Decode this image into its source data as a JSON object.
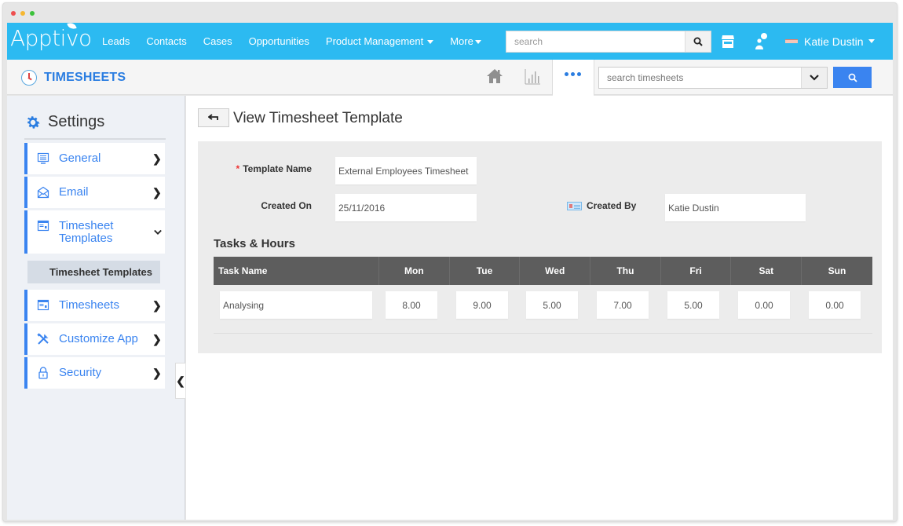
{
  "window": {
    "controls": [
      "close",
      "minimize",
      "maximize"
    ]
  },
  "topnav": {
    "brand": "Apptivo",
    "brand_color": "#2cbaf1",
    "items": [
      {
        "label": "Leads"
      },
      {
        "label": "Contacts"
      },
      {
        "label": "Cases"
      },
      {
        "label": "Opportunities"
      },
      {
        "label": "Product Management",
        "has_dropdown": true
      },
      {
        "label": "More",
        "has_dropdown": true
      }
    ],
    "search": {
      "placeholder": "search",
      "value": ""
    },
    "icons": [
      "search-icon",
      "store-icon",
      "people-icon"
    ],
    "user": {
      "name": "Katie Dustin"
    }
  },
  "subheader": {
    "app_title": "TIMESHEETS",
    "accent": "#2a7de1",
    "icons": [
      "home-icon",
      "bar-chart-icon",
      "more-dots-icon"
    ],
    "search": {
      "placeholder": "search timesheets",
      "value": ""
    }
  },
  "sidebar": {
    "heading": "Settings",
    "items": [
      {
        "label": "General",
        "icon": "monitor-icon",
        "expanded": false
      },
      {
        "label": "Email",
        "icon": "envelope-icon",
        "expanded": false
      },
      {
        "label": "Timesheet Templates",
        "icon": "template-icon",
        "expanded": true,
        "children": [
          {
            "label": "Timesheet Templates",
            "selected": true
          }
        ]
      },
      {
        "label": "Timesheets",
        "icon": "timesheet-icon",
        "expanded": false
      },
      {
        "label": "Customize App",
        "icon": "tools-icon",
        "expanded": false
      },
      {
        "label": "Security",
        "icon": "lock-icon",
        "expanded": false
      }
    ]
  },
  "main": {
    "title": "View Timesheet Template",
    "form": {
      "template_name": {
        "label": "Template Name",
        "required": true,
        "value": "External Employees Timesheet"
      },
      "created_on": {
        "label": "Created On",
        "value": "25/11/2016"
      },
      "created_by": {
        "label": "Created By",
        "value": "Katie Dustin"
      }
    },
    "tasks_section": {
      "title": "Tasks & Hours",
      "columns": [
        "Task Name",
        "Mon",
        "Tue",
        "Wed",
        "Thu",
        "Fri",
        "Sat",
        "Sun"
      ],
      "rows": [
        {
          "task": "Analysing",
          "hours": [
            "8.00",
            "9.00",
            "5.00",
            "7.00",
            "5.00",
            "0.00",
            "0.00"
          ]
        }
      ]
    }
  }
}
